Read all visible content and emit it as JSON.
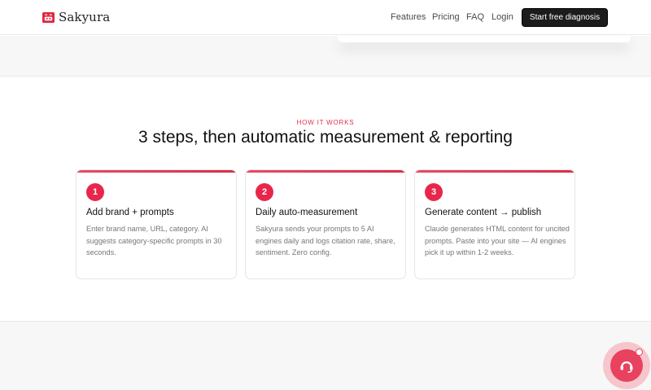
{
  "header": {
    "brand": "Sakyura",
    "nav": [
      {
        "label": "Features"
      },
      {
        "label": "Pricing"
      },
      {
        "label": "FAQ"
      },
      {
        "label": "Login"
      }
    ],
    "cta_label": "Start free diagnosis"
  },
  "section": {
    "eyebrow": "HOW IT WORKS",
    "title": "3 steps, then automatic measurement & reporting"
  },
  "steps": [
    {
      "number": "1",
      "title": "Add brand + prompts",
      "description": "Enter brand name, URL, category. AI suggests category-specific prompts in 30 seconds."
    },
    {
      "number": "2",
      "title": "Daily auto-measurement",
      "description": "Sakyura sends your prompts to 5 AI engines daily and logs citation rate, share, sentiment. Zero config."
    },
    {
      "number": "3",
      "title": "Generate content → publish",
      "description": "Claude generates HTML content for uncited prompts. Paste into your site — AI engines pick it up within 1-2 weeks."
    }
  ],
  "colors": {
    "accent": "#e8264b",
    "cta_bg": "#1c1c1c",
    "chat_ring": "#f6c6cd",
    "chat_core": "#e8425e"
  },
  "icons": {
    "logo": "cat-shop-icon",
    "chat": "chat-support-icon"
  }
}
